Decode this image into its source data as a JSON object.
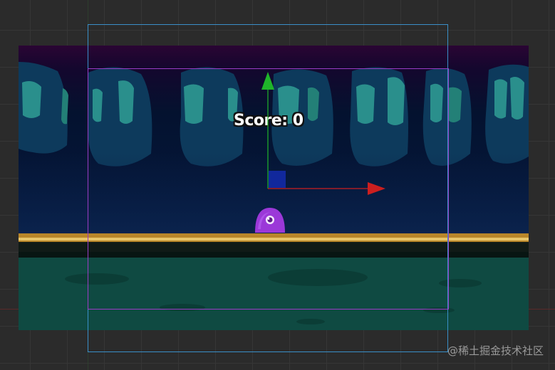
{
  "hud": {
    "score_text": "Score: 0"
  },
  "watermark": "@稀土掘金技术社区",
  "colors": {
    "sky_top": "#2a0533",
    "sky_bottom": "#031535",
    "window_glow": "#2f9f93",
    "ledge_gold": "#c99a2e",
    "ground": "#0f4a42",
    "player_purple": "#9b38d8",
    "camera_bounds": "#3a8fc8",
    "viewport_bounds": "#9a3cc4",
    "gizmo_x": "#cc1f1f",
    "gizmo_y": "#1fb52a",
    "gizmo_center": "#11289c"
  },
  "icons": {
    "player": "slime-character-icon",
    "gizmo_x": "x-axis-arrow-icon",
    "gizmo_y": "y-axis-arrow-icon",
    "gizmo_center": "center-handle-icon"
  }
}
